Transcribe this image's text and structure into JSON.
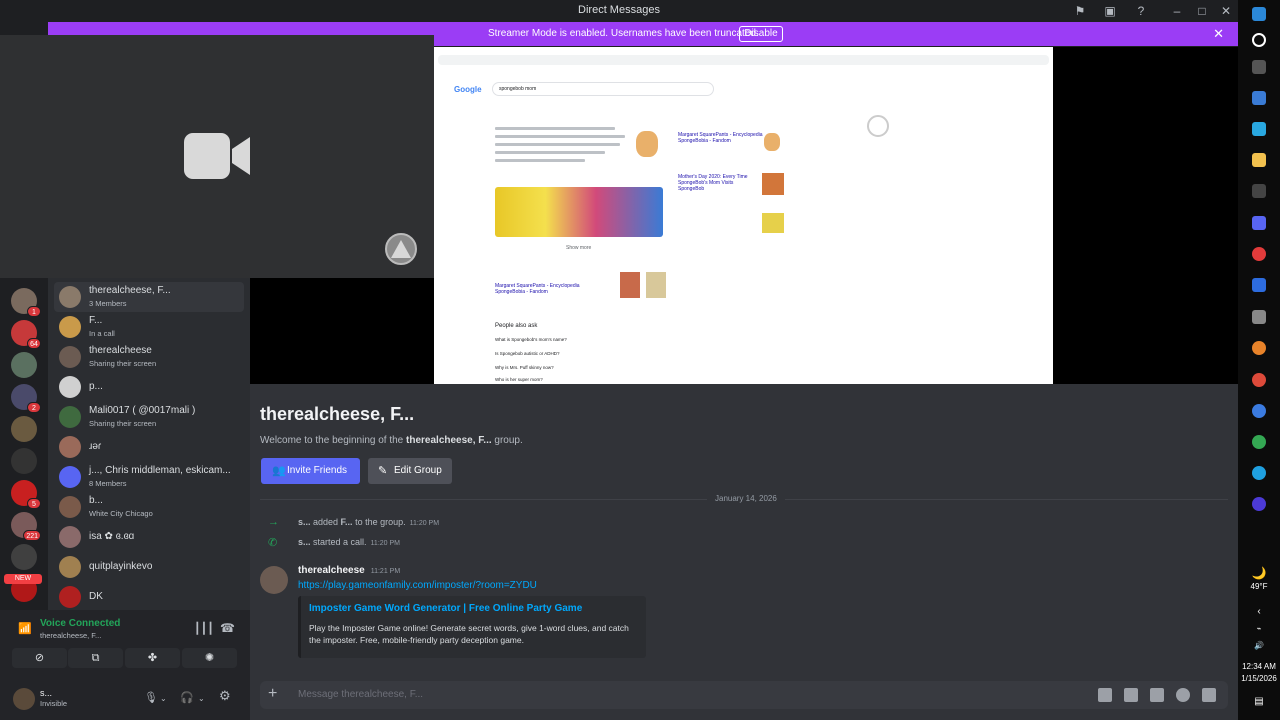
{
  "window": {
    "title": "Direct Messages"
  },
  "banner": {
    "message": "Streamer Mode is enabled. Usernames have been truncated.",
    "button": "Disable"
  },
  "servers": [
    {
      "badge": "1",
      "color": "#7a6a5e",
      "newtag": ""
    },
    {
      "badge": "64",
      "color": "#c6393a",
      "newtag": ""
    },
    {
      "badge": "",
      "color": "#5a7060",
      "newtag": ""
    },
    {
      "badge": "2",
      "color": "#4a4a6a",
      "newtag": ""
    },
    {
      "badge": "",
      "color": "#6a5a40",
      "newtag": ""
    },
    {
      "badge": "",
      "color": "#333333",
      "newtag": ""
    },
    {
      "badge": "5",
      "color": "#c82020",
      "newtag": ""
    },
    {
      "badge": "221",
      "color": "#7a5a5a",
      "newtag": ""
    },
    {
      "badge": "",
      "color": "#404040",
      "newtag": ""
    },
    {
      "badge": "",
      "color": "#b01818",
      "newtag": "NEW"
    }
  ],
  "dms": [
    {
      "name": "therealcheese, F...",
      "sub": "3 Members",
      "active": true,
      "color": "#8a7a6a"
    },
    {
      "name": "F...",
      "sub": "In a call",
      "active": false,
      "color": "#c99a4a"
    },
    {
      "name": "therealcheese",
      "sub": "Sharing their screen",
      "active": false,
      "color": "#6b5b52"
    },
    {
      "name": "p...",
      "sub": "",
      "active": false,
      "color": "#d0d0d0"
    },
    {
      "name": "Mali0017 ( @0017mali )",
      "sub": "Sharing their screen",
      "active": false,
      "color": "#3f6a3f"
    },
    {
      "name": "ɹəɾ",
      "sub": "",
      "active": false,
      "color": "#9a6a5a"
    },
    {
      "name": "j..., Chris middleman, eskicam...",
      "sub": "8 Members",
      "active": false,
      "color": "#5865f2"
    },
    {
      "name": "b...",
      "sub": "White City Chicago",
      "active": false,
      "color": "#7a5a4a"
    },
    {
      "name": "isa ✿ ɞ.ɞɑ",
      "sub": "",
      "active": false,
      "color": "#8a6a6a"
    },
    {
      "name": "quitplayinkevo",
      "sub": "",
      "active": false,
      "color": "#a08050"
    },
    {
      "name": "DK",
      "sub": "",
      "active": false,
      "color": "#b02020"
    }
  ],
  "voice": {
    "status": "Voice Connected",
    "channel": "therealcheese, F..."
  },
  "user": {
    "name": "s...",
    "status": "Invisible"
  },
  "chat": {
    "title": "therealcheese, F...",
    "welcome_prefix": "Welcome to the beginning of the ",
    "welcome_group": "therealcheese, F...",
    "welcome_suffix": " group.",
    "invite_label": "Invite Friends",
    "edit_label": "Edit Group",
    "date": "January 14, 2026",
    "system": [
      {
        "actor": "s...",
        "text": " added ",
        "target": "F...",
        "suffix": " to the group.",
        "time": "11:20 PM"
      },
      {
        "actor": "s...",
        "text": " started a call.",
        "target": "",
        "suffix": "",
        "time": "11:20 PM"
      }
    ],
    "message": {
      "author": "therealcheese",
      "time": "11:21 PM",
      "link": "https://play.gameonfamily.com/imposter/?room=ZYDU",
      "embed_title": "Imposter Game Word Generator | Free Online Party Game",
      "embed_desc": "Play the Imposter Game online! Generate secret words, give 1-word clues, and catch the imposter. Free, mobile-friendly party deception game."
    },
    "composer_placeholder": "Message therealcheese, F..."
  },
  "shared_screen": {
    "search_query": "spongebob mom",
    "result_title": "Margaret SquarePants - Encyclopedia SpongeBobia - Fandom",
    "people_also_ask": "People also ask",
    "show_more": "Show more",
    "side_title_1": "Margaret SquarePants - Encyclopedia SpongeBobia - Fandom",
    "side_title_2": "Mother's Day 2020: Every Time SpongeBob's Mom Visits SpongeBob",
    "paa": [
      "What is Spongebob's mom's name?",
      "Is Spongebob autistic or ADHD?",
      "Why is Mrs. Puff skinny now?",
      "Who is her super mom?"
    ]
  },
  "taskbar": {
    "weather": "49°F",
    "time": "12:34 AM",
    "date": "1/15/2026"
  }
}
